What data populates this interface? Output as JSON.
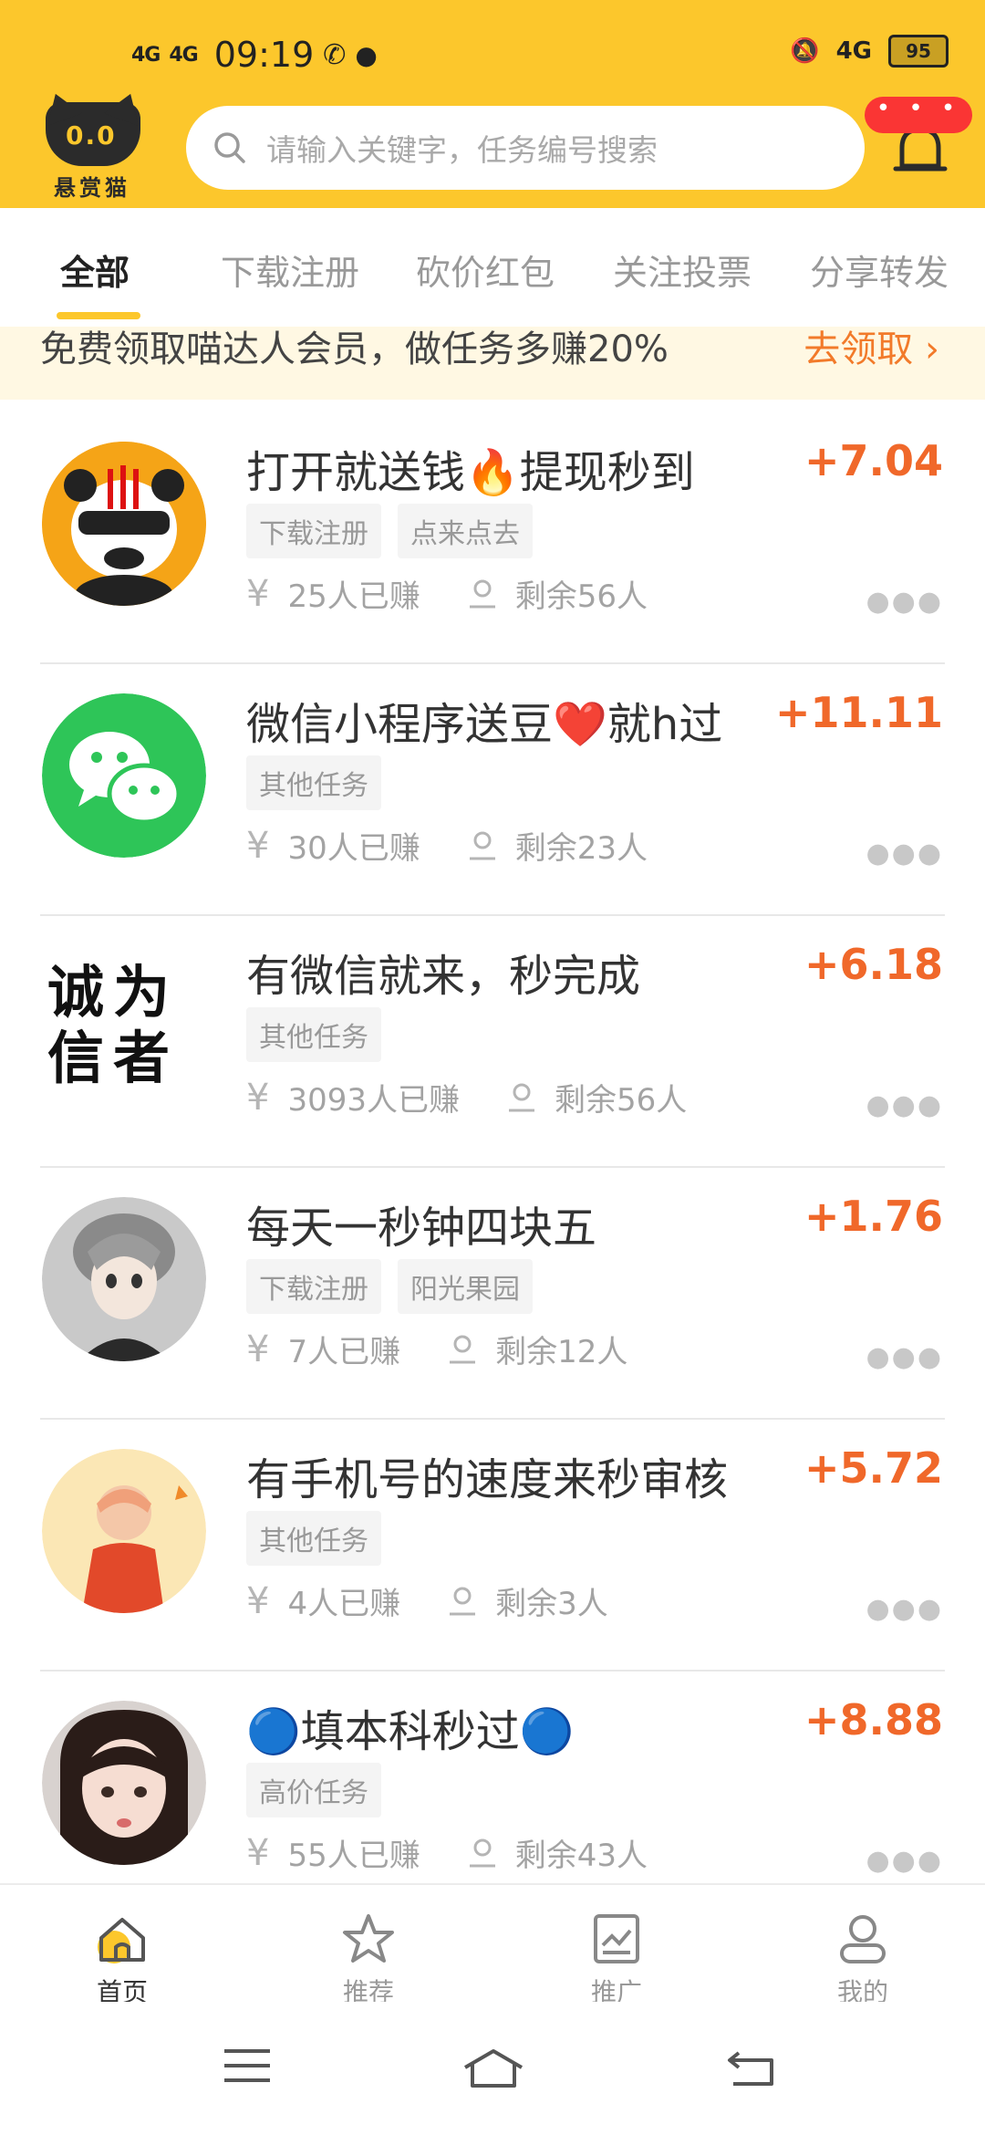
{
  "status_bar": {
    "signal1": "4G",
    "signal2": "4G",
    "time": "09:19",
    "network": "4G",
    "battery": "95"
  },
  "header": {
    "logo_eyes": "0.0",
    "logo_text": "悬赏猫",
    "search_placeholder": "请输入关键字，任务编号搜索",
    "pill_text": "• • •"
  },
  "tabs": [
    {
      "label": "全部",
      "active": true
    },
    {
      "label": "下载注册"
    },
    {
      "label": "砍价红包"
    },
    {
      "label": "关注投票"
    },
    {
      "label": "分享转发"
    }
  ],
  "banner": {
    "text": "免费领取喵达人会员，做任务多赚20%",
    "cta": "去领取 ›"
  },
  "tasks": [
    {
      "title": "打开就送钱🔥提现秒到",
      "reward": "+7.04",
      "tags": [
        "下载注册",
        "点来点去"
      ],
      "earned": "25人已赚",
      "remaining": "剩余56人"
    },
    {
      "title": "微信小程序送豆❤️就h过",
      "reward": "+11.11",
      "tags": [
        "其他任务"
      ],
      "earned": "30人已赚",
      "remaining": "剩余23人"
    },
    {
      "title": "有微信就来，秒完成",
      "reward": "+6.18",
      "tags": [
        "其他任务"
      ],
      "earned": "3093人已赚",
      "remaining": "剩余56人",
      "avatar_text": "诚为信者"
    },
    {
      "title": "每天一秒钟四块五",
      "reward": "+1.76",
      "tags": [
        "下载注册",
        "阳光果园"
      ],
      "earned": "7人已赚",
      "remaining": "剩余12人"
    },
    {
      "title": "有手机号的速度来秒审核",
      "reward": "+5.72",
      "tags": [
        "其他任务"
      ],
      "earned": "4人已赚",
      "remaining": "剩余3人"
    },
    {
      "title": "🔵填本科秒过🔵",
      "reward": "+8.88",
      "tags": [
        "高价任务"
      ],
      "earned": "55人已赚",
      "remaining": "剩余43人"
    }
  ],
  "bottom_nav": [
    {
      "label": "首页",
      "icon": "home-icon",
      "active": true
    },
    {
      "label": "推荐",
      "icon": "star-icon"
    },
    {
      "label": "推广",
      "icon": "chart-icon"
    },
    {
      "label": "我的",
      "icon": "user-icon"
    }
  ],
  "yen_symbol": "¥",
  "colors": {
    "brand_yellow": "#fcc72c",
    "reward_orange": "#f0682a",
    "badge_red": "#fa3534"
  }
}
